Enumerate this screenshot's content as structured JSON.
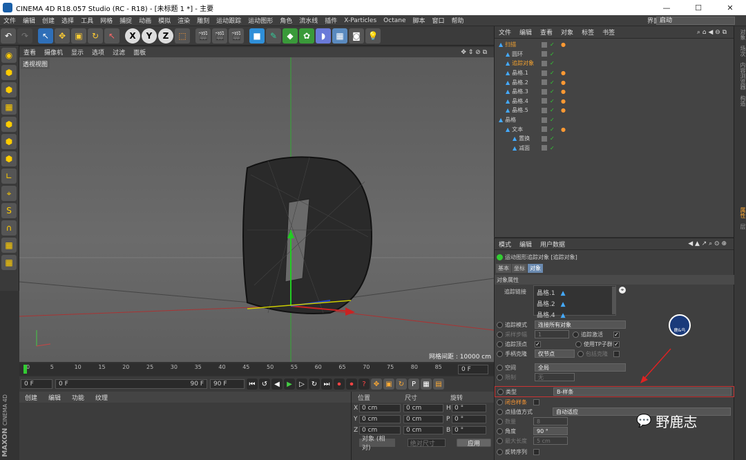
{
  "titlebar": {
    "title": "CINEMA 4D R18.057 Studio (RC - R18) - [未标题 1 *] - 主要",
    "minimize": "—",
    "maximize": "☐",
    "close": "✕"
  },
  "menu": [
    "文件",
    "编辑",
    "创建",
    "选择",
    "工具",
    "网格",
    "捕捉",
    "动画",
    "模拟",
    "渲染",
    "雕刻",
    "运动跟踪",
    "运动图形",
    "角色",
    "流水线",
    "插件",
    "X-Particles",
    "Octane",
    "脚本",
    "窗口",
    "帮助"
  ],
  "layout": {
    "label": "界面:",
    "value": "启动"
  },
  "viewport": {
    "menu": [
      "查看",
      "摄像机",
      "显示",
      "选项",
      "过滤",
      "面板"
    ],
    "name": "透视视图",
    "grid_info": "网格间距 : 10000 cm"
  },
  "timeline": {
    "ticks": [
      "0",
      "5",
      "10",
      "15",
      "20",
      "25",
      "30",
      "35",
      "40",
      "45",
      "50",
      "55",
      "60",
      "65",
      "70",
      "75",
      "80",
      "85",
      "90"
    ],
    "frame_box": "0 F"
  },
  "playback": {
    "start": "0 F",
    "range_start": "0 F",
    "range_end": "90 F",
    "end": "90 F"
  },
  "materials": {
    "menu": [
      "创建",
      "编辑",
      "功能",
      "纹理"
    ]
  },
  "coords": {
    "headers": [
      "位置",
      "尺寸",
      "旋转"
    ],
    "rows": [
      {
        "axis": "X",
        "pos": "0 cm",
        "size": "0 cm",
        "rl": "H",
        "rot": "0 °"
      },
      {
        "axis": "Y",
        "pos": "0 cm",
        "size": "0 cm",
        "rl": "P",
        "rot": "0 °"
      },
      {
        "axis": "Z",
        "pos": "0 cm",
        "size": "0 cm",
        "rl": "B",
        "rot": "0 °"
      }
    ],
    "mode": "对象 (相对)",
    "size_mode": "绝对尺寸",
    "apply": "应用"
  },
  "brand": {
    "maxon": "MAXON",
    "cinema": "CINEMA 4D"
  },
  "objmgr": {
    "menu": [
      "文件",
      "编辑",
      "查看",
      "对象",
      "标签",
      "书签"
    ],
    "objects": [
      {
        "name": "扫描",
        "depth": 0,
        "color": "#f0a030",
        "tag": true
      },
      {
        "name": "圆环",
        "depth": 1,
        "color": "#ccc",
        "tag": false
      },
      {
        "name": "追踪对象",
        "depth": 1,
        "color": "#f0a030",
        "tag": false
      },
      {
        "name": "晶格.1",
        "depth": 1,
        "color": "#ccc",
        "tag": true
      },
      {
        "name": "晶格.2",
        "depth": 1,
        "color": "#ccc",
        "tag": true
      },
      {
        "name": "晶格.3",
        "depth": 1,
        "color": "#ccc",
        "tag": true
      },
      {
        "name": "晶格.4",
        "depth": 1,
        "color": "#ccc",
        "tag": true
      },
      {
        "name": "晶格.5",
        "depth": 1,
        "color": "#ccc",
        "tag": true
      },
      {
        "name": "晶格",
        "depth": 0,
        "color": "#ccc",
        "tag": false
      },
      {
        "name": "文本",
        "depth": 1,
        "color": "#ccc",
        "tag": true
      },
      {
        "name": "置换",
        "depth": 2,
        "color": "#ccc",
        "tag": false
      },
      {
        "name": "减面",
        "depth": 2,
        "color": "#ccc",
        "tag": false
      }
    ]
  },
  "sidetabs": [
    "对象",
    "场次",
    "内容浏览器",
    "构造"
  ],
  "sidetabs2": [
    "属性",
    "层"
  ],
  "attr": {
    "menu": [
      "模式",
      "编辑",
      "用户数据"
    ],
    "object_title": "运动图形追踪对象 [追踪对象]",
    "tabs": [
      "基本",
      "坐标",
      "对象"
    ],
    "section": "对象属性",
    "trace_link_label": "追踪链接",
    "trace_links": [
      "晶格.1",
      "晶格.2",
      "晶格.4"
    ],
    "trace_mode_label": "追踪模式",
    "trace_mode": "连接所有对象",
    "sample_step_label": "采样步幅",
    "sample_step": "1",
    "trace_active_label": "追踪激活",
    "trace_vertices_label": "追踪顶点",
    "use_tp_label": "使用TP子群",
    "handle_clone_label": "手柄克隆",
    "handle_clone": "仅节点",
    "include_clone_label": "包括克隆",
    "space_label": "空间",
    "space": "全局",
    "limit_label": "限制",
    "limit": "无",
    "type_label": "类型",
    "type": "B-样条",
    "closed_label": "闭合样条",
    "interp_label": "点插值方式",
    "interp": "自动适应",
    "count_label": "数量",
    "count": "8",
    "angle_label": "角度",
    "angle": "90 °",
    "maxlen_label": "最大长度",
    "maxlen": "5 cm",
    "reverse_label": "反转序列"
  },
  "watermark": {
    "logo": "野鹿志",
    "badge": "鹿&鸟"
  }
}
